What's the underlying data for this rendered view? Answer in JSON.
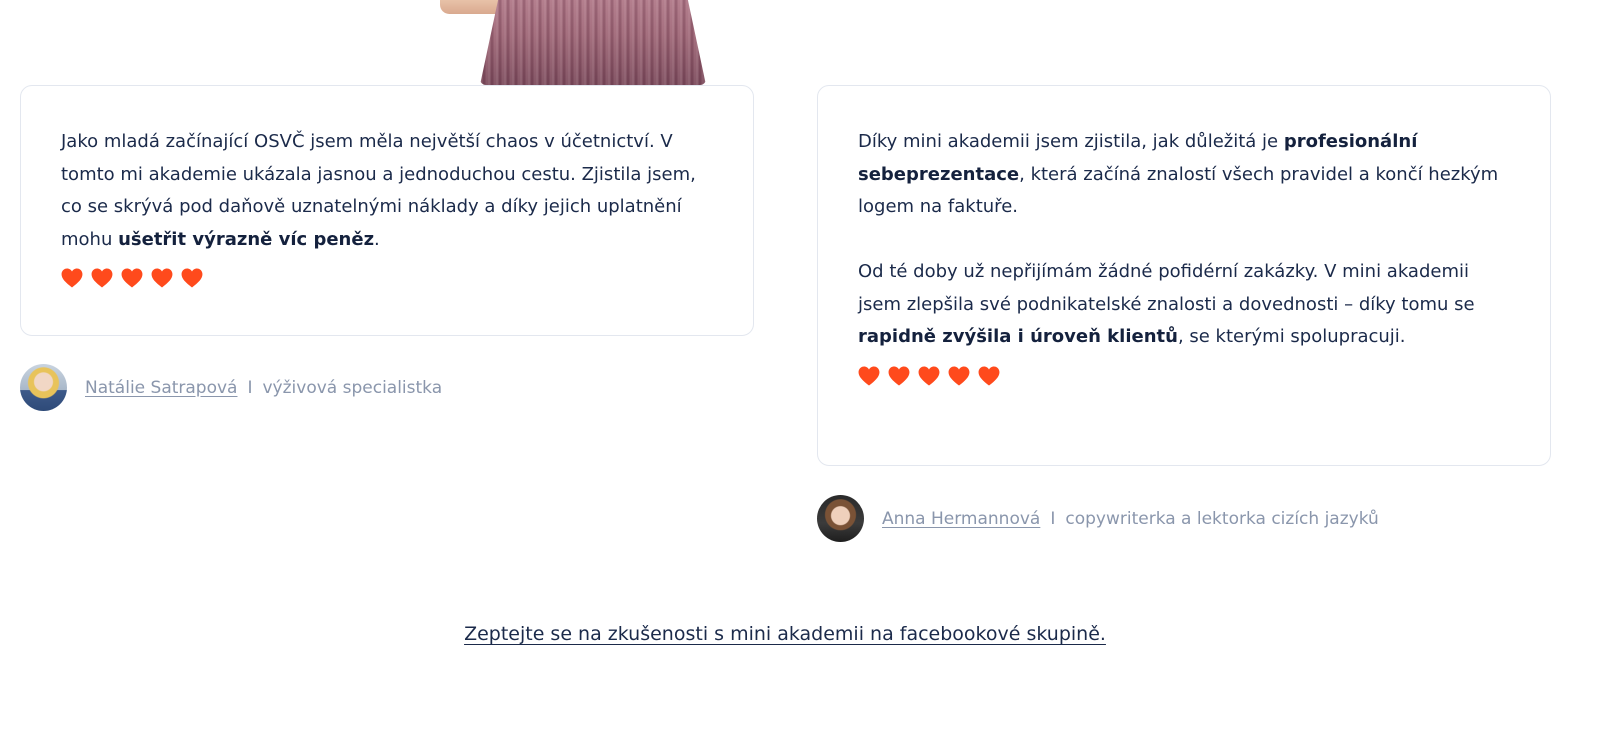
{
  "testimonials": [
    {
      "paragraphs": [
        [
          {
            "text": "Jako mladá začínající OSVČ jsem měla největší chaos v účetnictví. V tomto mi akademie ukázala jasnou a jednoduchou cestu. Zjistila jsem, co se skrývá pod daňově uznatelnými náklady a díky jejich uplatnění mohu ",
            "bold": false
          },
          {
            "text": "ušetřit výrazně víc peněz",
            "bold": true
          },
          {
            "text": ".",
            "bold": false
          }
        ]
      ],
      "rating": 5,
      "author": {
        "name": "Natálie Satrapová",
        "separator": "I",
        "role": "výživová specialistka"
      }
    },
    {
      "paragraphs": [
        [
          {
            "text": "Díky mini akademii jsem zjistila, jak důležitá je ",
            "bold": false
          },
          {
            "text": "profesionální sebeprezentace",
            "bold": true
          },
          {
            "text": ", která začíná znalostí všech pravidel a končí hezkým logem na faktuře.",
            "bold": false
          }
        ],
        [
          {
            "text": "Od té doby už nepřijímám žádné pofidérní zakázky. V mini akademii jsem zlepšila své podnikatelské znalosti a dovednosti – díky tomu se ",
            "bold": false
          },
          {
            "text": "rapidně zvýšila i úroveň klientů",
            "bold": true
          },
          {
            "text": ", se kterými spolupracuji.",
            "bold": false
          }
        ]
      ],
      "rating": 5,
      "author": {
        "name": "Anna Hermannová",
        "separator": "I",
        "role": "copywriterka a lektorka cizích jazyků"
      }
    }
  ],
  "heart_color": "#ff4a1c",
  "facebook_link": "Zeptejte se na zkušenosti s mini akademii na facebookové skupině."
}
